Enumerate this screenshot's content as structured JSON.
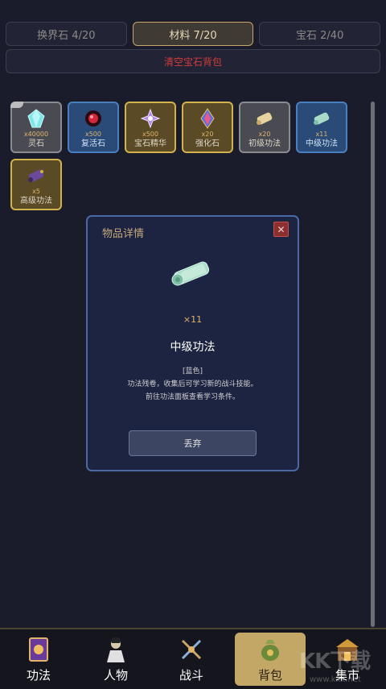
{
  "tabs": [
    {
      "label": "换界石 4/20"
    },
    {
      "label": "材料 7/20"
    },
    {
      "label": "宝石 2/40"
    }
  ],
  "clear_button": "清空宝石背包",
  "items": [
    {
      "name": "灵石",
      "count": "x40000",
      "rarity": "gray",
      "icon": "crystal-icon"
    },
    {
      "name": "复活石",
      "count": "x500",
      "rarity": "blue",
      "icon": "red-gem-icon"
    },
    {
      "name": "宝石精华",
      "count": "x500",
      "rarity": "gold",
      "icon": "purple-gem-icon"
    },
    {
      "name": "强化石",
      "count": "x20",
      "rarity": "gold",
      "icon": "colorful-gem-icon"
    },
    {
      "name": "初级功法",
      "count": "x20",
      "rarity": "gray",
      "icon": "scroll-icon"
    },
    {
      "name": "中级功法",
      "count": "x11",
      "rarity": "blue",
      "icon": "scroll-icon"
    },
    {
      "name": "高级功法",
      "count": "x5",
      "rarity": "gold",
      "icon": "purple-scroll-icon"
    }
  ],
  "modal": {
    "title": "物品详情",
    "count": "×11",
    "name": "中级功法",
    "grade": "[蓝色]",
    "desc_line1": "功法残卷，收集后可学习新的战斗技能。",
    "desc_line2": "前往功法面板查看学习条件。",
    "discard": "丢弃",
    "close": "✕"
  },
  "nav": [
    {
      "label": "功法",
      "icon": "skill-book-icon"
    },
    {
      "label": "人物",
      "icon": "character-icon"
    },
    {
      "label": "战斗",
      "icon": "crossed-swords-icon"
    },
    {
      "label": "背包",
      "icon": "bag-icon"
    },
    {
      "label": "集市",
      "icon": "market-icon"
    }
  ],
  "watermark": "KK下载",
  "watermark_sub": "www.kkx.net",
  "colors": {
    "accent_gold": "#c3a767",
    "rarity_blue": "#4a7fbf",
    "rarity_gold": "#d2b24a",
    "danger_red": "#d13b3b"
  }
}
